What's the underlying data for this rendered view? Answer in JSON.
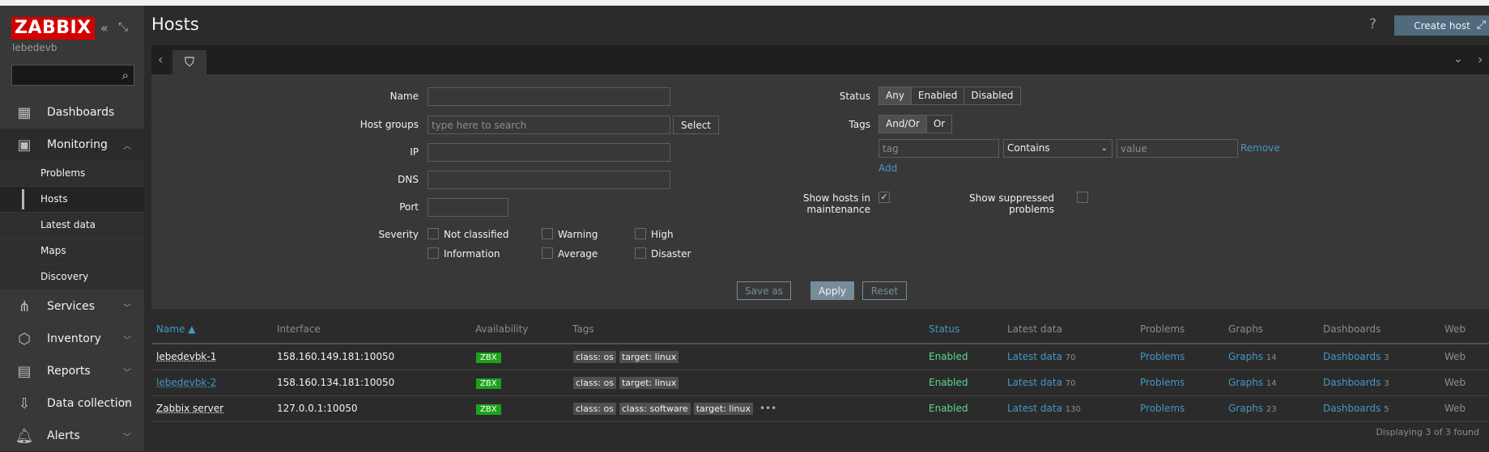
{
  "sidebar": {
    "logo": "ZABBIX",
    "username": "lebedevb",
    "menu": [
      {
        "label": "Dashboards",
        "icon": "dashboards-icon"
      },
      {
        "label": "Monitoring",
        "icon": "monitoring-icon"
      },
      {
        "label": "Services",
        "icon": "services-icon"
      },
      {
        "label": "Inventory",
        "icon": "inventory-icon"
      },
      {
        "label": "Reports",
        "icon": "reports-icon"
      },
      {
        "label": "Data collection",
        "icon": "data-collection-icon"
      },
      {
        "label": "Alerts",
        "icon": "alerts-icon"
      }
    ],
    "submenu": [
      "Problems",
      "Hosts",
      "Latest data",
      "Maps",
      "Discovery"
    ],
    "active_submenu": "Hosts"
  },
  "header": {
    "title": "Hosts",
    "help": "?",
    "create_button": "Create host"
  },
  "filter": {
    "name_label": "Name",
    "name_value": "",
    "host_groups_label": "Host groups",
    "host_groups_placeholder": "type here to search",
    "select_button": "Select",
    "ip_label": "IP",
    "dns_label": "DNS",
    "port_label": "Port",
    "severity_label": "Severity",
    "severities": [
      "Not classified",
      "Warning",
      "High",
      "Information",
      "Average",
      "Disaster"
    ],
    "status_label": "Status",
    "status_options": [
      "Any",
      "Enabled",
      "Disabled"
    ],
    "status_selected": "Any",
    "tags_label": "Tags",
    "tags_options": [
      "And/Or",
      "Or"
    ],
    "tags_selected": "And/Or",
    "tag_placeholder": "tag",
    "tag_operator": "Contains",
    "value_placeholder": "value",
    "remove_link": "Remove",
    "add_link": "Add",
    "show_maintenance_label": "Show hosts in maintenance",
    "show_maintenance_checked": true,
    "show_suppressed_label": "Show suppressed problems",
    "show_suppressed_checked": false,
    "save_as_button": "Save as",
    "apply_button": "Apply",
    "reset_button": "Reset"
  },
  "table": {
    "columns": [
      "Name ▲",
      "Interface",
      "Availability",
      "Tags",
      "Status",
      "Latest data",
      "Problems",
      "Graphs",
      "Dashboards",
      "Web"
    ],
    "rows": [
      {
        "name": "lebedevbk-1",
        "interface": "158.160.149.181:10050",
        "availability": "ZBX",
        "tags": [
          "class: os",
          "target: linux"
        ],
        "status": "Enabled",
        "latest_data": "Latest data",
        "latest_count": "70",
        "problems": "Problems",
        "graphs": "Graphs",
        "graphs_count": "14",
        "dashboards": "Dashboards",
        "dashboards_count": "3",
        "web": "Web"
      },
      {
        "name": "lebedevbk-2",
        "interface": "158.160.134.181:10050",
        "availability": "ZBX",
        "tags": [
          "class: os",
          "target: linux"
        ],
        "status": "Enabled",
        "latest_data": "Latest data",
        "latest_count": "70",
        "problems": "Problems",
        "graphs": "Graphs",
        "graphs_count": "14",
        "dashboards": "Dashboards",
        "dashboards_count": "3",
        "web": "Web"
      },
      {
        "name": "Zabbix server",
        "interface": "127.0.0.1:10050",
        "availability": "ZBX",
        "tags": [
          "class: os",
          "class: software",
          "target: linux"
        ],
        "more_tags": "•••",
        "status": "Enabled",
        "latest_data": "Latest data",
        "latest_count": "130",
        "problems": "Problems",
        "graphs": "Graphs",
        "graphs_count": "23",
        "dashboards": "Dashboards",
        "dashboards_count": "5",
        "web": "Web"
      }
    ],
    "footer": "Displaying 3 of 3 found"
  }
}
